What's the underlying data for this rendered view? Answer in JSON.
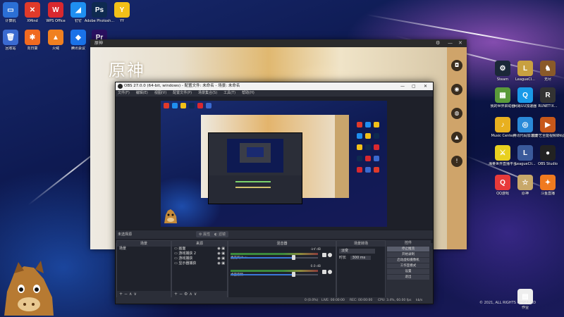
{
  "desktop": {
    "left_icons": [
      {
        "label": "计算机",
        "glyph": "▭",
        "color": "#2b6fd6"
      },
      {
        "label": "XMind",
        "glyph": "✕",
        "color": "#e03a2a"
      },
      {
        "label": "WPS Office",
        "glyph": "W",
        "color": "#d9282f"
      },
      {
        "label": "钉钉",
        "glyph": "◢",
        "color": "#1f8ff0"
      },
      {
        "label": "Adobe Photosh...",
        "glyph": "Ps",
        "color": "#0e2a50"
      },
      {
        "label": "YY",
        "glyph": "Y",
        "color": "#f2c018"
      },
      {
        "label": "回收站",
        "glyph": "🗑",
        "color": "#3a6ad0"
      },
      {
        "label": "向日葵",
        "glyph": "✱",
        "color": "#f06a20"
      },
      {
        "label": "火绒",
        "glyph": "▲",
        "color": "#f08020"
      },
      {
        "label": "腾讯会议",
        "glyph": "◆",
        "color": "#1a72e8"
      },
      {
        "label": "Pr",
        "glyph": "Pr",
        "color": "#2a1060"
      }
    ],
    "right_icons": [
      {
        "label": "Steam",
        "glyph": "⚙",
        "color": "#1b2838"
      },
      {
        "label": "LeagueCl...",
        "glyph": "L",
        "color": "#c8a040"
      },
      {
        "label": "无尽",
        "glyph": "♞",
        "color": "#8a5a2a"
      },
      {
        "label": "我的世界启动器",
        "glyph": "▦",
        "color": "#5a9a3a"
      },
      {
        "label": "网易UU加速器",
        "glyph": "Q",
        "color": "#1a9ae8"
      },
      {
        "label": "RUNET!X...",
        "glyph": "R",
        "color": "#333333"
      },
      {
        "label": "Music Center",
        "glyph": "♪",
        "color": "#e8b020"
      },
      {
        "label": "腾讯代码加速器",
        "glyph": "◎",
        "color": "#2a8ad8"
      },
      {
        "label": "爱奇艺全能视频转码器",
        "glyph": "▶",
        "color": "#c8581a"
      },
      {
        "label": "海量世界直播平台",
        "glyph": "⚔",
        "color": "#e8d020"
      },
      {
        "label": "LeagueCli...",
        "glyph": "L",
        "color": "#3a5a9a"
      },
      {
        "label": "OBS Studio",
        "glyph": "●",
        "color": "#222222"
      },
      {
        "label": "QQ游戏",
        "glyph": "Q",
        "color": "#e83a3a"
      },
      {
        "label": "原神",
        "glyph": "☆",
        "color": "#c8a86a"
      },
      {
        "label": "斗鱼直播",
        "glyph": "✦",
        "color": "#f07a20"
      },
      {
        "label": "作业",
        "glyph": "▤",
        "color": "#eeeeee"
      }
    ],
    "copyright": "© 2021, ALL RIGHTS RESERVED"
  },
  "launcher": {
    "title": "原神",
    "logo_text": "原神",
    "side_icons": [
      "discord-icon",
      "wechat-icon",
      "weibo-icon",
      "bilibili-icon",
      "notice-icon"
    ]
  },
  "obs": {
    "title": "OBS 27.0.0 (64-bit, windows) - 配置文件: 未命名 - 场景: 未命名",
    "menu": [
      "文件(F)",
      "编辑(E)",
      "视图(V)",
      "配置文件(P)",
      "场景集合(S)",
      "工具(T)",
      "帮助(H)"
    ],
    "no_source": "未选择源",
    "prop_btn": "属性",
    "filter_btn": "滤镜",
    "scenes_header": "场景",
    "scenes": [
      "场景"
    ],
    "sources_header": "来源",
    "sources": [
      "画面",
      "游戏捕获 2",
      "游戏捕获",
      "显示器捕获"
    ],
    "mixer_header": "混音器",
    "mixer": [
      {
        "name": "麦克风/Aux",
        "db": "-inf dB",
        "level": 0.72
      },
      {
        "name": "桌面音频",
        "db": "0.0 dB",
        "level": 0.72
      }
    ],
    "transitions_header": "场景转场",
    "transition": "淡变",
    "duration_label": "时长",
    "duration": "300 ms",
    "controls_header": "控件",
    "controls": [
      "停止推流",
      "开始录制",
      "启动虚拟摄像机",
      "工作室模式",
      "设置",
      "退出"
    ],
    "status": {
      "dropped": "0 (0.0%)",
      "live": "LIVE: 00:00:00",
      "rec": "REC: 00:00:00",
      "cpu": "CPU: 3.4%, 60.00 fps",
      "kbps": "kb/s"
    }
  }
}
